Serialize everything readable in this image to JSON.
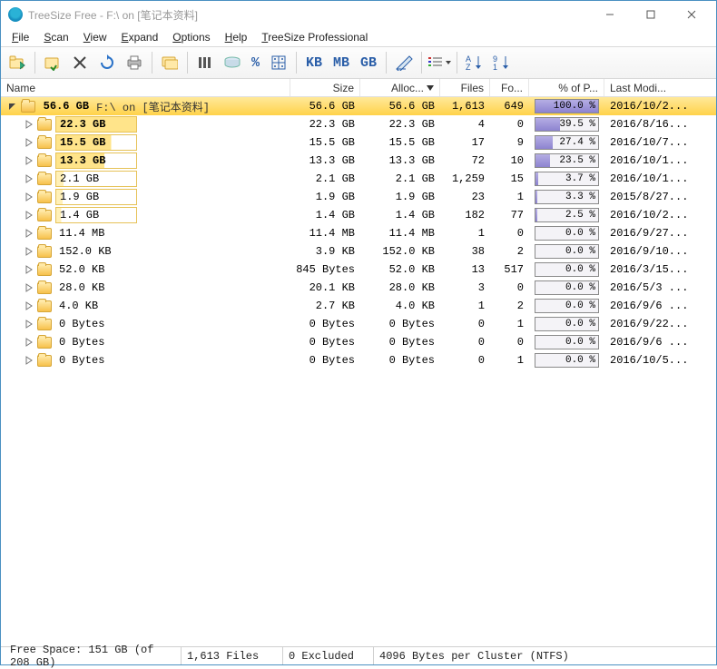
{
  "window": {
    "title": "TreeSize Free - F:\\  on  [笔记本资料]"
  },
  "menu": {
    "file": "File",
    "scan": "Scan",
    "view": "View",
    "expand": "Expand",
    "options": "Options",
    "help": "Help",
    "pro": "TreeSize Professional"
  },
  "toolbar": {
    "percent_label": "%",
    "kb": "KB",
    "mb": "MB",
    "gb": "GB"
  },
  "columns": {
    "name": "Name",
    "size": "Size",
    "alloc": "Alloc...",
    "files": "Files",
    "folders": "Fo...",
    "pct": "% of P...",
    "modified": "Last Modi..."
  },
  "rows": [
    {
      "level": 0,
      "expanded": true,
      "selected": true,
      "bar_pct": 100,
      "size_label": "56.6 GB",
      "path": "F:\\  on  [笔记本资料]",
      "size": "56.6 GB",
      "alloc": "56.6 GB",
      "files": "1,613",
      "folders": "649",
      "pct": "100.0 %",
      "pct_val": 100,
      "modified": "2016/10/2..."
    },
    {
      "level": 1,
      "expanded": false,
      "bar_pct": 100,
      "bold": true,
      "size_label": "22.3 GB",
      "size": "22.3 GB",
      "alloc": "22.3 GB",
      "files": "4",
      "folders": "0",
      "pct": "39.5 %",
      "pct_val": 39.5,
      "modified": "2016/8/16..."
    },
    {
      "level": 1,
      "expanded": false,
      "bar_pct": 69,
      "bold": true,
      "size_label": "15.5 GB",
      "size": "15.5 GB",
      "alloc": "15.5 GB",
      "files": "17",
      "folders": "9",
      "pct": "27.4 %",
      "pct_val": 27.4,
      "modified": "2016/10/7..."
    },
    {
      "level": 1,
      "expanded": false,
      "bar_pct": 60,
      "bold": true,
      "size_label": "13.3 GB",
      "size": "13.3 GB",
      "alloc": "13.3 GB",
      "files": "72",
      "folders": "10",
      "pct": "23.5 %",
      "pct_val": 23.5,
      "modified": "2016/10/1..."
    },
    {
      "level": 1,
      "expanded": false,
      "bar_pct": 9,
      "size_label": "2.1 GB",
      "size": "2.1 GB",
      "alloc": "2.1 GB",
      "files": "1,259",
      "folders": "15",
      "pct": "3.7 %",
      "pct_val": 3.7,
      "modified": "2016/10/1..."
    },
    {
      "level": 1,
      "expanded": false,
      "bar_pct": 8,
      "size_label": "1.9 GB",
      "size": "1.9 GB",
      "alloc": "1.9 GB",
      "files": "23",
      "folders": "1",
      "pct": "3.3 %",
      "pct_val": 3.3,
      "modified": "2015/8/27..."
    },
    {
      "level": 1,
      "expanded": false,
      "bar_pct": 6,
      "size_label": "1.4 GB",
      "size": "1.4 GB",
      "alloc": "1.4 GB",
      "files": "182",
      "folders": "77",
      "pct": "2.5 %",
      "pct_val": 2.5,
      "modified": "2016/10/2..."
    },
    {
      "level": 1,
      "expanded": false,
      "bar_pct": 0,
      "size_label": "11.4 MB",
      "size": "11.4 MB",
      "alloc": "11.4 MB",
      "files": "1",
      "folders": "0",
      "pct": "0.0 %",
      "pct_val": 0,
      "modified": "2016/9/27..."
    },
    {
      "level": 1,
      "expanded": false,
      "bar_pct": 0,
      "size_label": "152.0 KB",
      "size": "3.9 KB",
      "alloc": "152.0 KB",
      "files": "38",
      "folders": "2",
      "pct": "0.0 %",
      "pct_val": 0,
      "modified": "2016/9/10..."
    },
    {
      "level": 1,
      "expanded": false,
      "bar_pct": 0,
      "size_label": "52.0 KB",
      "size": "845 Bytes",
      "alloc": "52.0 KB",
      "files": "13",
      "folders": "517",
      "pct": "0.0 %",
      "pct_val": 0,
      "modified": "2016/3/15..."
    },
    {
      "level": 1,
      "expanded": false,
      "bar_pct": 0,
      "size_label": "28.0 KB",
      "size": "20.1 KB",
      "alloc": "28.0 KB",
      "files": "3",
      "folders": "0",
      "pct": "0.0 %",
      "pct_val": 0,
      "modified": "2016/5/3 ..."
    },
    {
      "level": 1,
      "expanded": false,
      "bar_pct": 0,
      "size_label": "4.0 KB",
      "size": "2.7 KB",
      "alloc": "4.0 KB",
      "files": "1",
      "folders": "2",
      "pct": "0.0 %",
      "pct_val": 0,
      "modified": "2016/9/6 ..."
    },
    {
      "level": 1,
      "expanded": false,
      "bar_pct": 0,
      "size_label": "0 Bytes",
      "size": "0 Bytes",
      "alloc": "0 Bytes",
      "files": "0",
      "folders": "1",
      "pct": "0.0 %",
      "pct_val": 0,
      "modified": "2016/9/22..."
    },
    {
      "level": 1,
      "expanded": false,
      "bar_pct": 0,
      "size_label": "0 Bytes",
      "size": "0 Bytes",
      "alloc": "0 Bytes",
      "files": "0",
      "folders": "0",
      "pct": "0.0 %",
      "pct_val": 0,
      "modified": "2016/9/6 ..."
    },
    {
      "level": 1,
      "expanded": false,
      "bar_pct": 0,
      "size_label": "0 Bytes",
      "size": "0 Bytes",
      "alloc": "0 Bytes",
      "files": "0",
      "folders": "1",
      "pct": "0.0 %",
      "pct_val": 0,
      "modified": "2016/10/5..."
    }
  ],
  "statusbar": {
    "free": "Free Space: 151 GB  (of 208 GB)",
    "files": "1,613  Files",
    "excluded": "0 Excluded",
    "cluster": "4096  Bytes per Cluster (NTFS)"
  }
}
